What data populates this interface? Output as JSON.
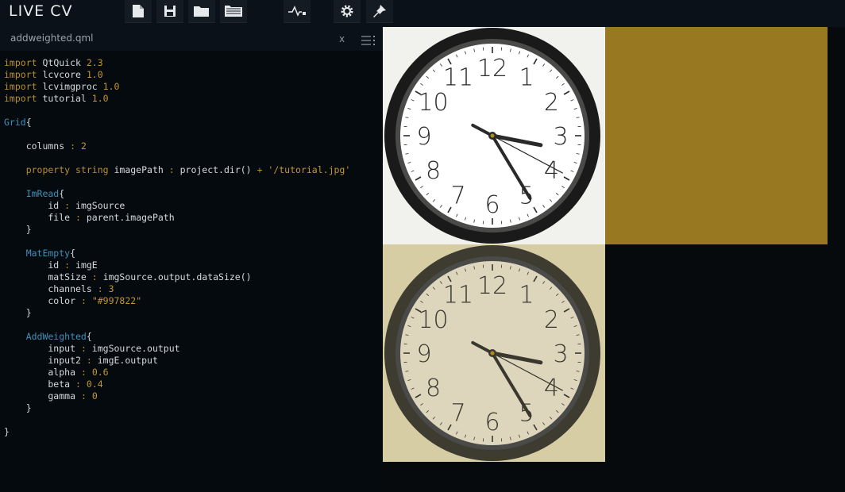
{
  "app": {
    "title": "LIVE CV"
  },
  "toolbar": {
    "icons": [
      "new-file-icon",
      "save-icon",
      "open-folder-icon",
      "open-project-icon",
      "log-icon",
      "settings-icon",
      "pin-icon"
    ]
  },
  "editor": {
    "filename": "addweighted.qml",
    "close_label": "x",
    "lines": [
      [
        {
          "t": "import",
          "c": "kw"
        },
        {
          "t": " QtQuick ",
          "c": "pl"
        },
        {
          "t": "2.3",
          "c": "num"
        }
      ],
      [
        {
          "t": "import",
          "c": "kw"
        },
        {
          "t": " lcvcore ",
          "c": "pl"
        },
        {
          "t": "1.0",
          "c": "num"
        }
      ],
      [
        {
          "t": "import",
          "c": "kw"
        },
        {
          "t": " lcvimgproc ",
          "c": "pl"
        },
        {
          "t": "1.0",
          "c": "num"
        }
      ],
      [
        {
          "t": "import",
          "c": "kw"
        },
        {
          "t": " tutorial ",
          "c": "pl"
        },
        {
          "t": "1.0",
          "c": "num"
        }
      ],
      [],
      [
        {
          "t": "Grid",
          "c": "ty"
        },
        {
          "t": "{",
          "c": "pl"
        }
      ],
      [],
      [
        {
          "t": "    columns ",
          "c": "pl"
        },
        {
          "t": ":",
          "c": "kw"
        },
        {
          "t": " ",
          "c": "pl"
        },
        {
          "t": "2",
          "c": "num"
        }
      ],
      [],
      [
        {
          "t": "    property string",
          "c": "kw"
        },
        {
          "t": " imagePath ",
          "c": "pl"
        },
        {
          "t": ":",
          "c": "kw"
        },
        {
          "t": " project.dir() ",
          "c": "pl"
        },
        {
          "t": "+",
          "c": "kw"
        },
        {
          "t": " ",
          "c": "pl"
        },
        {
          "t": "'/tutorial.jpg'",
          "c": "str"
        }
      ],
      [],
      [
        {
          "t": "    ImRead",
          "c": "ty"
        },
        {
          "t": "{",
          "c": "pl"
        }
      ],
      [
        {
          "t": "        id ",
          "c": "pl"
        },
        {
          "t": ":",
          "c": "kw"
        },
        {
          "t": " imgSource",
          "c": "pl"
        }
      ],
      [
        {
          "t": "        file ",
          "c": "pl"
        },
        {
          "t": ":",
          "c": "kw"
        },
        {
          "t": " parent.imagePath",
          "c": "pl"
        }
      ],
      [
        {
          "t": "    }",
          "c": "pl"
        }
      ],
      [],
      [
        {
          "t": "    MatEmpty",
          "c": "ty"
        },
        {
          "t": "{",
          "c": "pl"
        }
      ],
      [
        {
          "t": "        id ",
          "c": "pl"
        },
        {
          "t": ":",
          "c": "kw"
        },
        {
          "t": " imgE",
          "c": "pl"
        }
      ],
      [
        {
          "t": "        matSize ",
          "c": "pl"
        },
        {
          "t": ":",
          "c": "kw"
        },
        {
          "t": " imgSource.output.dataSize()",
          "c": "pl"
        }
      ],
      [
        {
          "t": "        channels ",
          "c": "pl"
        },
        {
          "t": ":",
          "c": "kw"
        },
        {
          "t": " ",
          "c": "pl"
        },
        {
          "t": "3",
          "c": "num"
        }
      ],
      [
        {
          "t": "        color ",
          "c": "pl"
        },
        {
          "t": ":",
          "c": "kw"
        },
        {
          "t": " ",
          "c": "pl"
        },
        {
          "t": "\"#997822\"",
          "c": "str"
        }
      ],
      [
        {
          "t": "    }",
          "c": "pl"
        }
      ],
      [],
      [
        {
          "t": "    AddWeighted",
          "c": "ty"
        },
        {
          "t": "{",
          "c": "pl"
        }
      ],
      [
        {
          "t": "        input ",
          "c": "pl"
        },
        {
          "t": ":",
          "c": "kw"
        },
        {
          "t": " imgSource.output",
          "c": "pl"
        }
      ],
      [
        {
          "t": "        input2 ",
          "c": "pl"
        },
        {
          "t": ":",
          "c": "kw"
        },
        {
          "t": " imgE.output",
          "c": "pl"
        }
      ],
      [
        {
          "t": "        alpha ",
          "c": "pl"
        },
        {
          "t": ":",
          "c": "kw"
        },
        {
          "t": " ",
          "c": "pl"
        },
        {
          "t": "0.6",
          "c": "num"
        }
      ],
      [
        {
          "t": "        beta ",
          "c": "pl"
        },
        {
          "t": ":",
          "c": "kw"
        },
        {
          "t": " ",
          "c": "pl"
        },
        {
          "t": "0.4",
          "c": "num"
        }
      ],
      [
        {
          "t": "        gamma ",
          "c": "pl"
        },
        {
          "t": ":",
          "c": "kw"
        },
        {
          "t": " ",
          "c": "pl"
        },
        {
          "t": "0",
          "c": "num"
        }
      ],
      [
        {
          "t": "    }",
          "c": "pl"
        }
      ],
      [],
      [
        {
          "t": "}",
          "c": "pl"
        }
      ]
    ]
  },
  "viewer": {
    "panels": [
      {
        "name": "imread-output",
        "kind": "clock",
        "bg": "#f1f1ee",
        "rim": "#1a1a1a",
        "face": "#ffffff",
        "ink": "#2a2a2a"
      },
      {
        "name": "matempty-output",
        "kind": "solid",
        "color": "#997822"
      },
      {
        "name": "addweighted-output",
        "kind": "clock",
        "bg": "#d6cda5",
        "rim": "#3e3b30",
        "face": "#ddd6bd",
        "ink": "#3a382e"
      }
    ],
    "clock_numbers": [
      "12",
      "1",
      "2",
      "3",
      "4",
      "5",
      "6",
      "7",
      "8",
      "9",
      "10",
      "11"
    ]
  }
}
